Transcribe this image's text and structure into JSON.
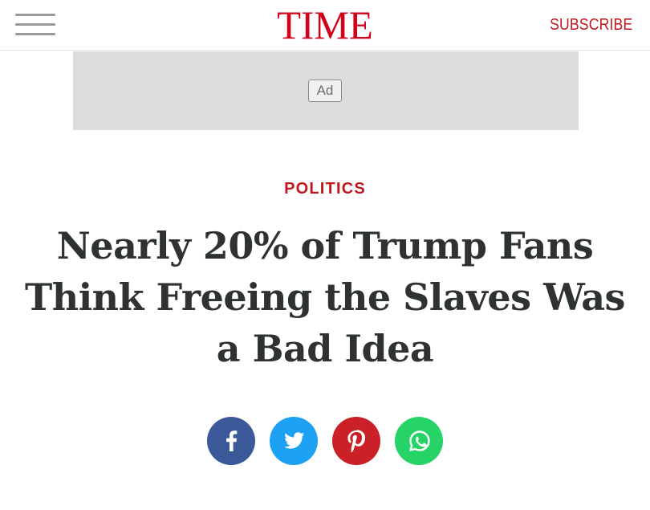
{
  "header": {
    "logo": "TIME",
    "subscribe_label": "SUBSCRIBE",
    "menu_icon": "hamburger-menu-icon",
    "brand_color": "#d0021b"
  },
  "ad": {
    "label": "Ad",
    "background": "#dcdcdc"
  },
  "article": {
    "section": "POLITICS",
    "headline": "Nearly 20% of Trump Fans Think Freeing the Slaves Was a Bad Idea"
  },
  "share": {
    "buttons": [
      {
        "name": "facebook",
        "icon": "facebook-icon",
        "color": "#3b5998"
      },
      {
        "name": "twitter",
        "icon": "twitter-icon",
        "color": "#1da1f2"
      },
      {
        "name": "pinterest",
        "icon": "pinterest-icon",
        "color": "#cb2027"
      },
      {
        "name": "whatsapp",
        "icon": "whatsapp-icon",
        "color": "#25d366"
      }
    ]
  }
}
